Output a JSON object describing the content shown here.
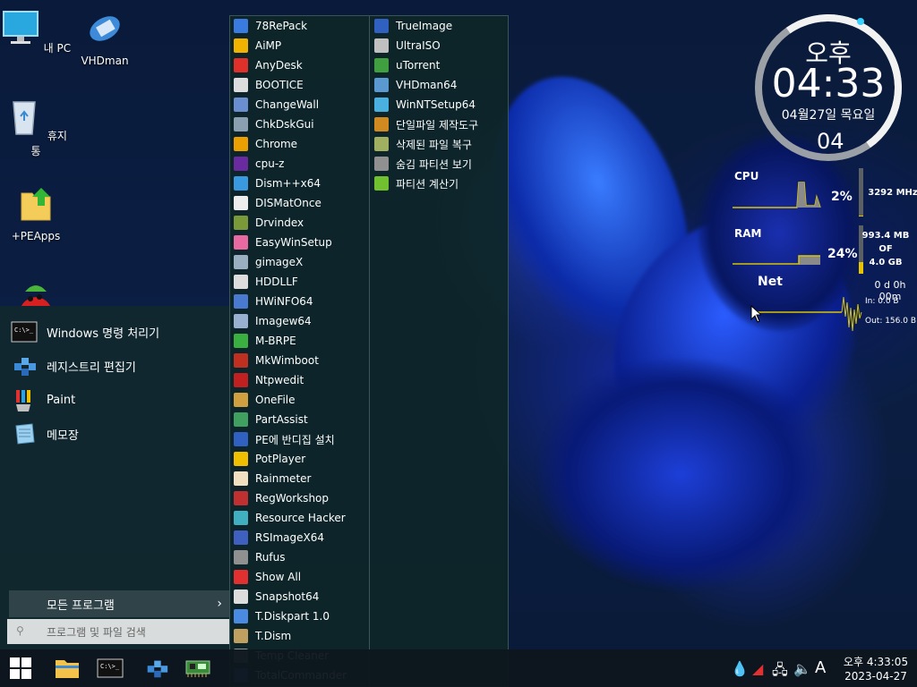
{
  "desktop": {
    "icons": [
      {
        "label": "내 PC",
        "icon": "monitor-icon"
      },
      {
        "label": "VHDman",
        "icon": "vhdman-icon"
      },
      {
        "label": "휴지통",
        "icon": "recycle-bin-icon"
      },
      {
        "label": "+PEApps",
        "icon": "folder-icon"
      }
    ]
  },
  "start_menu": {
    "pinned": [
      {
        "label": "Windows 명령 처리기",
        "icon": "cmd-icon"
      },
      {
        "label": "레지스트리 편집기",
        "icon": "regedit-icon"
      },
      {
        "label": "Paint",
        "icon": "paint-icon"
      },
      {
        "label": "메모장",
        "icon": "notepad-icon"
      }
    ],
    "all_programs": "모든 프로그램",
    "search_placeholder": "프로그램 및 파일 검색"
  },
  "programs": {
    "col1": [
      "78RePack",
      "AiMP",
      "AnyDesk",
      "BOOTICE",
      "ChangeWall",
      "ChkDskGui",
      "Chrome",
      "cpu-z",
      "Dism++x64",
      "DISMatOnce",
      "Drvindex",
      "EasyWinSetup",
      "gimageX",
      "HDDLLF",
      "HWiNFO64",
      "Imagew64",
      "M-BRPE",
      "MkWimboot",
      "Ntpwedit",
      "OneFile",
      "PartAssist",
      "PE에 반디집 설치",
      "PotPlayer",
      "Rainmeter",
      "RegWorkshop",
      "Resource Hacker",
      "RSImageX64",
      "Rufus",
      "Show All",
      "Snapshot64",
      "T.Diskpart 1.0",
      "T.Dism",
      "Temp Cleaner",
      "TotalCommander"
    ],
    "col2": [
      "TrueImage",
      "UltraISO",
      "uTorrent",
      "VHDman64",
      "WinNTSetup64",
      "단일파일 제작도구",
      "삭제된 파일 복구",
      "숨김 파티션 보기",
      "파티션 계산기"
    ],
    "icon_colors1": [
      "#3a7be0",
      "#f0b400",
      "#e0302a",
      "#dddddd",
      "#6a8fd0",
      "#8aa0b0",
      "#e9a000",
      "#6a2aa0",
      "#3a9ae0",
      "#eeeeee",
      "#7a9a3a",
      "#e86aa0",
      "#9ab0c0",
      "#dddddd",
      "#4a7ad0",
      "#9ab0d0",
      "#3ab040",
      "#c03020",
      "#c02020",
      "#d0a040",
      "#40a060",
      "#3060c0",
      "#f0c000",
      "#f0e0c0",
      "#c03030",
      "#40b0c0",
      "#4060c0",
      "#909090",
      "#e03030",
      "#dddddd",
      "#4a8ae0",
      "#c0a060",
      "#909090",
      "#3060c0"
    ],
    "icon_colors2": [
      "#3060c0",
      "#c0c0c0",
      "#40a040",
      "#5a9ad0",
      "#4ab0e0",
      "#d08a20",
      "#a0b060",
      "#909090",
      "#70c030"
    ]
  },
  "clock": {
    "ampm": "오후",
    "time": "04:33",
    "date": "04월27일 목요일",
    "seconds": "04"
  },
  "meters": {
    "cpu_label": "CPU",
    "cpu_pct": "2%",
    "cpu_freq": "3292 MHz",
    "cpu_level": 0.02,
    "ram_label": "RAM",
    "ram_pct": "24%",
    "ram_used": "993.4 MB",
    "ram_of": "OF",
    "ram_total": "4.0 GB",
    "ram_level": 0.24,
    "uptime": "0 d 0h 00m",
    "net_label": "Net",
    "net_in": "In: 0.0 B",
    "net_out": "Out: 156.0 B"
  },
  "taskbar": {
    "time": "오후 4:33:05",
    "date": "2023-04-27",
    "ime": "A"
  }
}
